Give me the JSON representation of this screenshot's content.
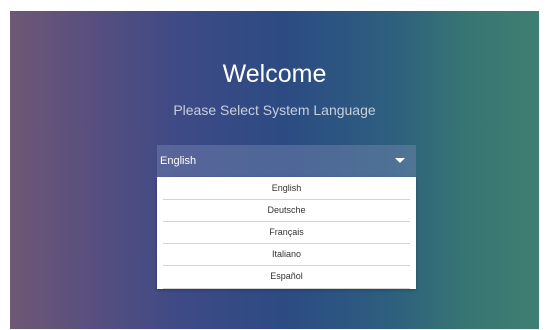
{
  "welcome": {
    "title": "Welcome",
    "subtitle": "Please Select System Language"
  },
  "language_select": {
    "selected": "English",
    "caret_icon": "caret-down-icon",
    "options": [
      "English",
      "Deutsche",
      "Français",
      "Italiano",
      "Español"
    ]
  },
  "colors": {
    "background_gradient": [
      "#6f5775",
      "#2c4b83",
      "#3f7f72"
    ],
    "title_text": "#ffffff",
    "subtitle_text": "#c7cfdb",
    "dropdown_bg": "#ffffff",
    "option_text": "#333333"
  }
}
